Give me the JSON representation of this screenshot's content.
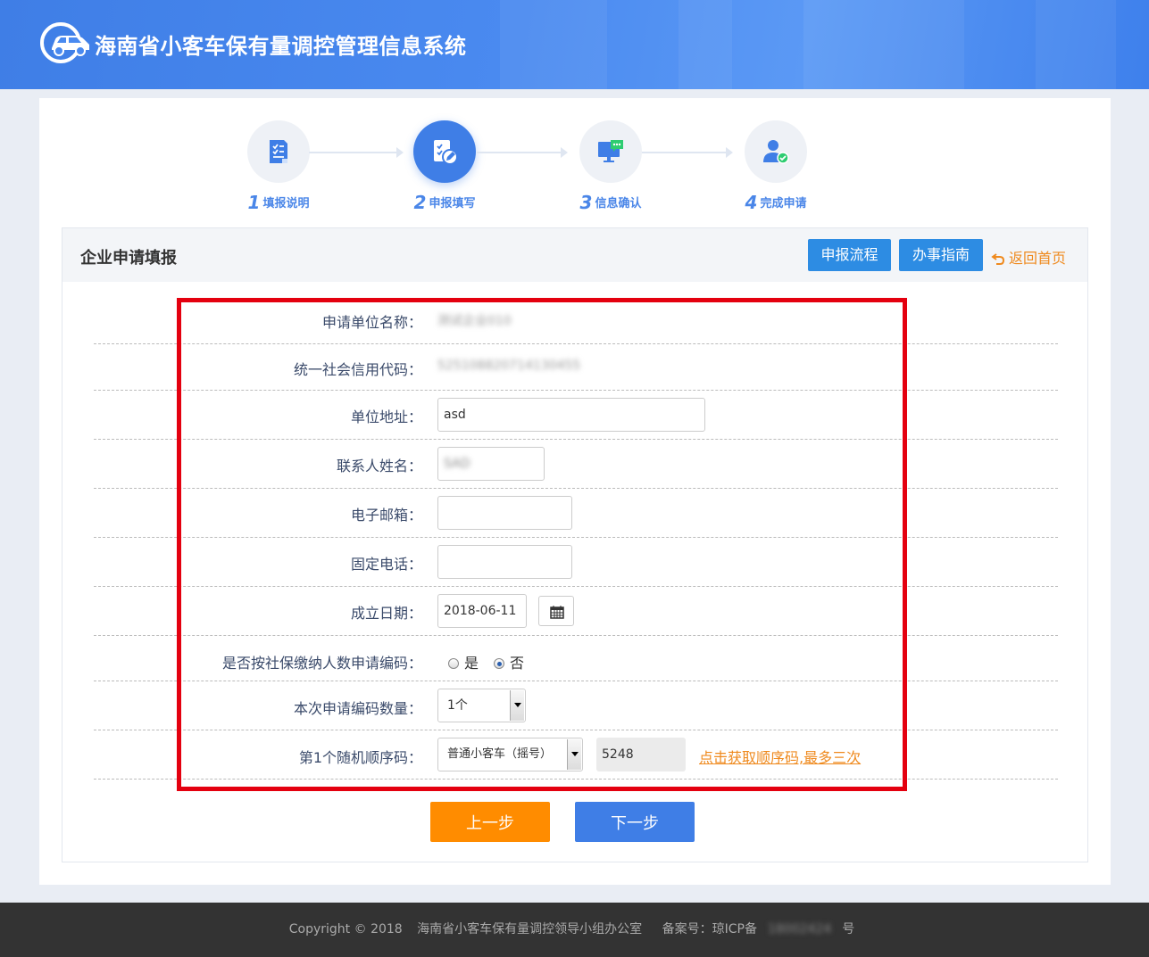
{
  "header": {
    "title": "海南省小客车保有量调控管理信息系统"
  },
  "steps": [
    {
      "num": "1",
      "label": "填报说明"
    },
    {
      "num": "2",
      "label": "申报填写"
    },
    {
      "num": "3",
      "label": "信息确认"
    },
    {
      "num": "4",
      "label": "完成申请"
    }
  ],
  "panel": {
    "title": "企业申请填报",
    "flow_button": "申报流程",
    "guide_button": "办事指南",
    "back_link": "返回首页"
  },
  "form": {
    "company_name_label": "申请单位名称：",
    "company_name_value": "测试企业010",
    "credit_code_label": "统一社会信用代码：",
    "credit_code_value": "525108820714130455",
    "address_label": "单位地址：",
    "address_value": "asd",
    "contact_label": "联系人姓名：",
    "contact_value": "SAD",
    "email_label": "电子邮箱：",
    "email_value": "",
    "phone_label": "固定电话：",
    "phone_value": "",
    "date_label": "成立日期：",
    "date_value": "2018-06-11",
    "social_label": "是否按社保缴纳人数申请编码：",
    "social_yes": "是",
    "social_no": "否",
    "social_selected": "否",
    "quantity_label": "本次申请编码数量：",
    "quantity_value": "1个",
    "seq_label": "第1个随机顺序码：",
    "seq_type_value": "普通小客车（摇号）",
    "seq_code_value": "5248",
    "seq_get_link": "点击获取顺序码,最多三次"
  },
  "buttons": {
    "prev": "上一步",
    "next": "下一步"
  },
  "footer": {
    "copyright": "Copyright  © 2018",
    "org": "海南省小客车保有量调控领导小组办公室",
    "icp_prefix": "备案号：琼ICP备",
    "icp_number": "18002424",
    "icp_suffix": "号"
  },
  "colors": {
    "accent_blue": "#3f7ee6",
    "orange": "#ff8c00",
    "highlight_red": "#e4000f"
  }
}
